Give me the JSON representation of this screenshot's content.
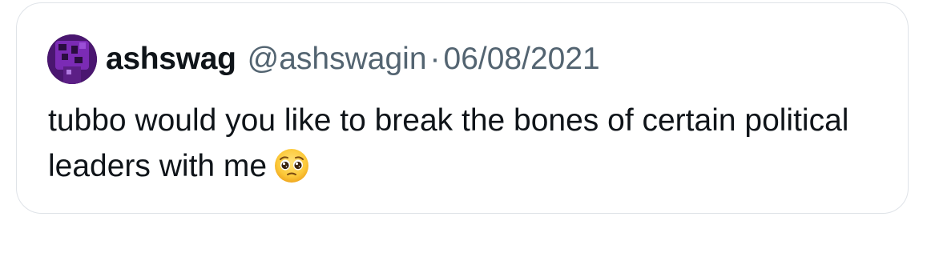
{
  "quote": {
    "author": {
      "display_name": "ashswag",
      "handle": "@ashswagin",
      "avatar_icon": "avatar-image"
    },
    "separator": "·",
    "date": "06/08/2021",
    "text": "tubbo would you like to break the bones of certain political leaders with me",
    "emoji_icon": "pleading-face-emoji"
  },
  "colors": {
    "border": "#dfe3e8",
    "text_primary": "#0f1419",
    "text_secondary": "#536471",
    "avatar_purple": "#6b1fa0"
  }
}
